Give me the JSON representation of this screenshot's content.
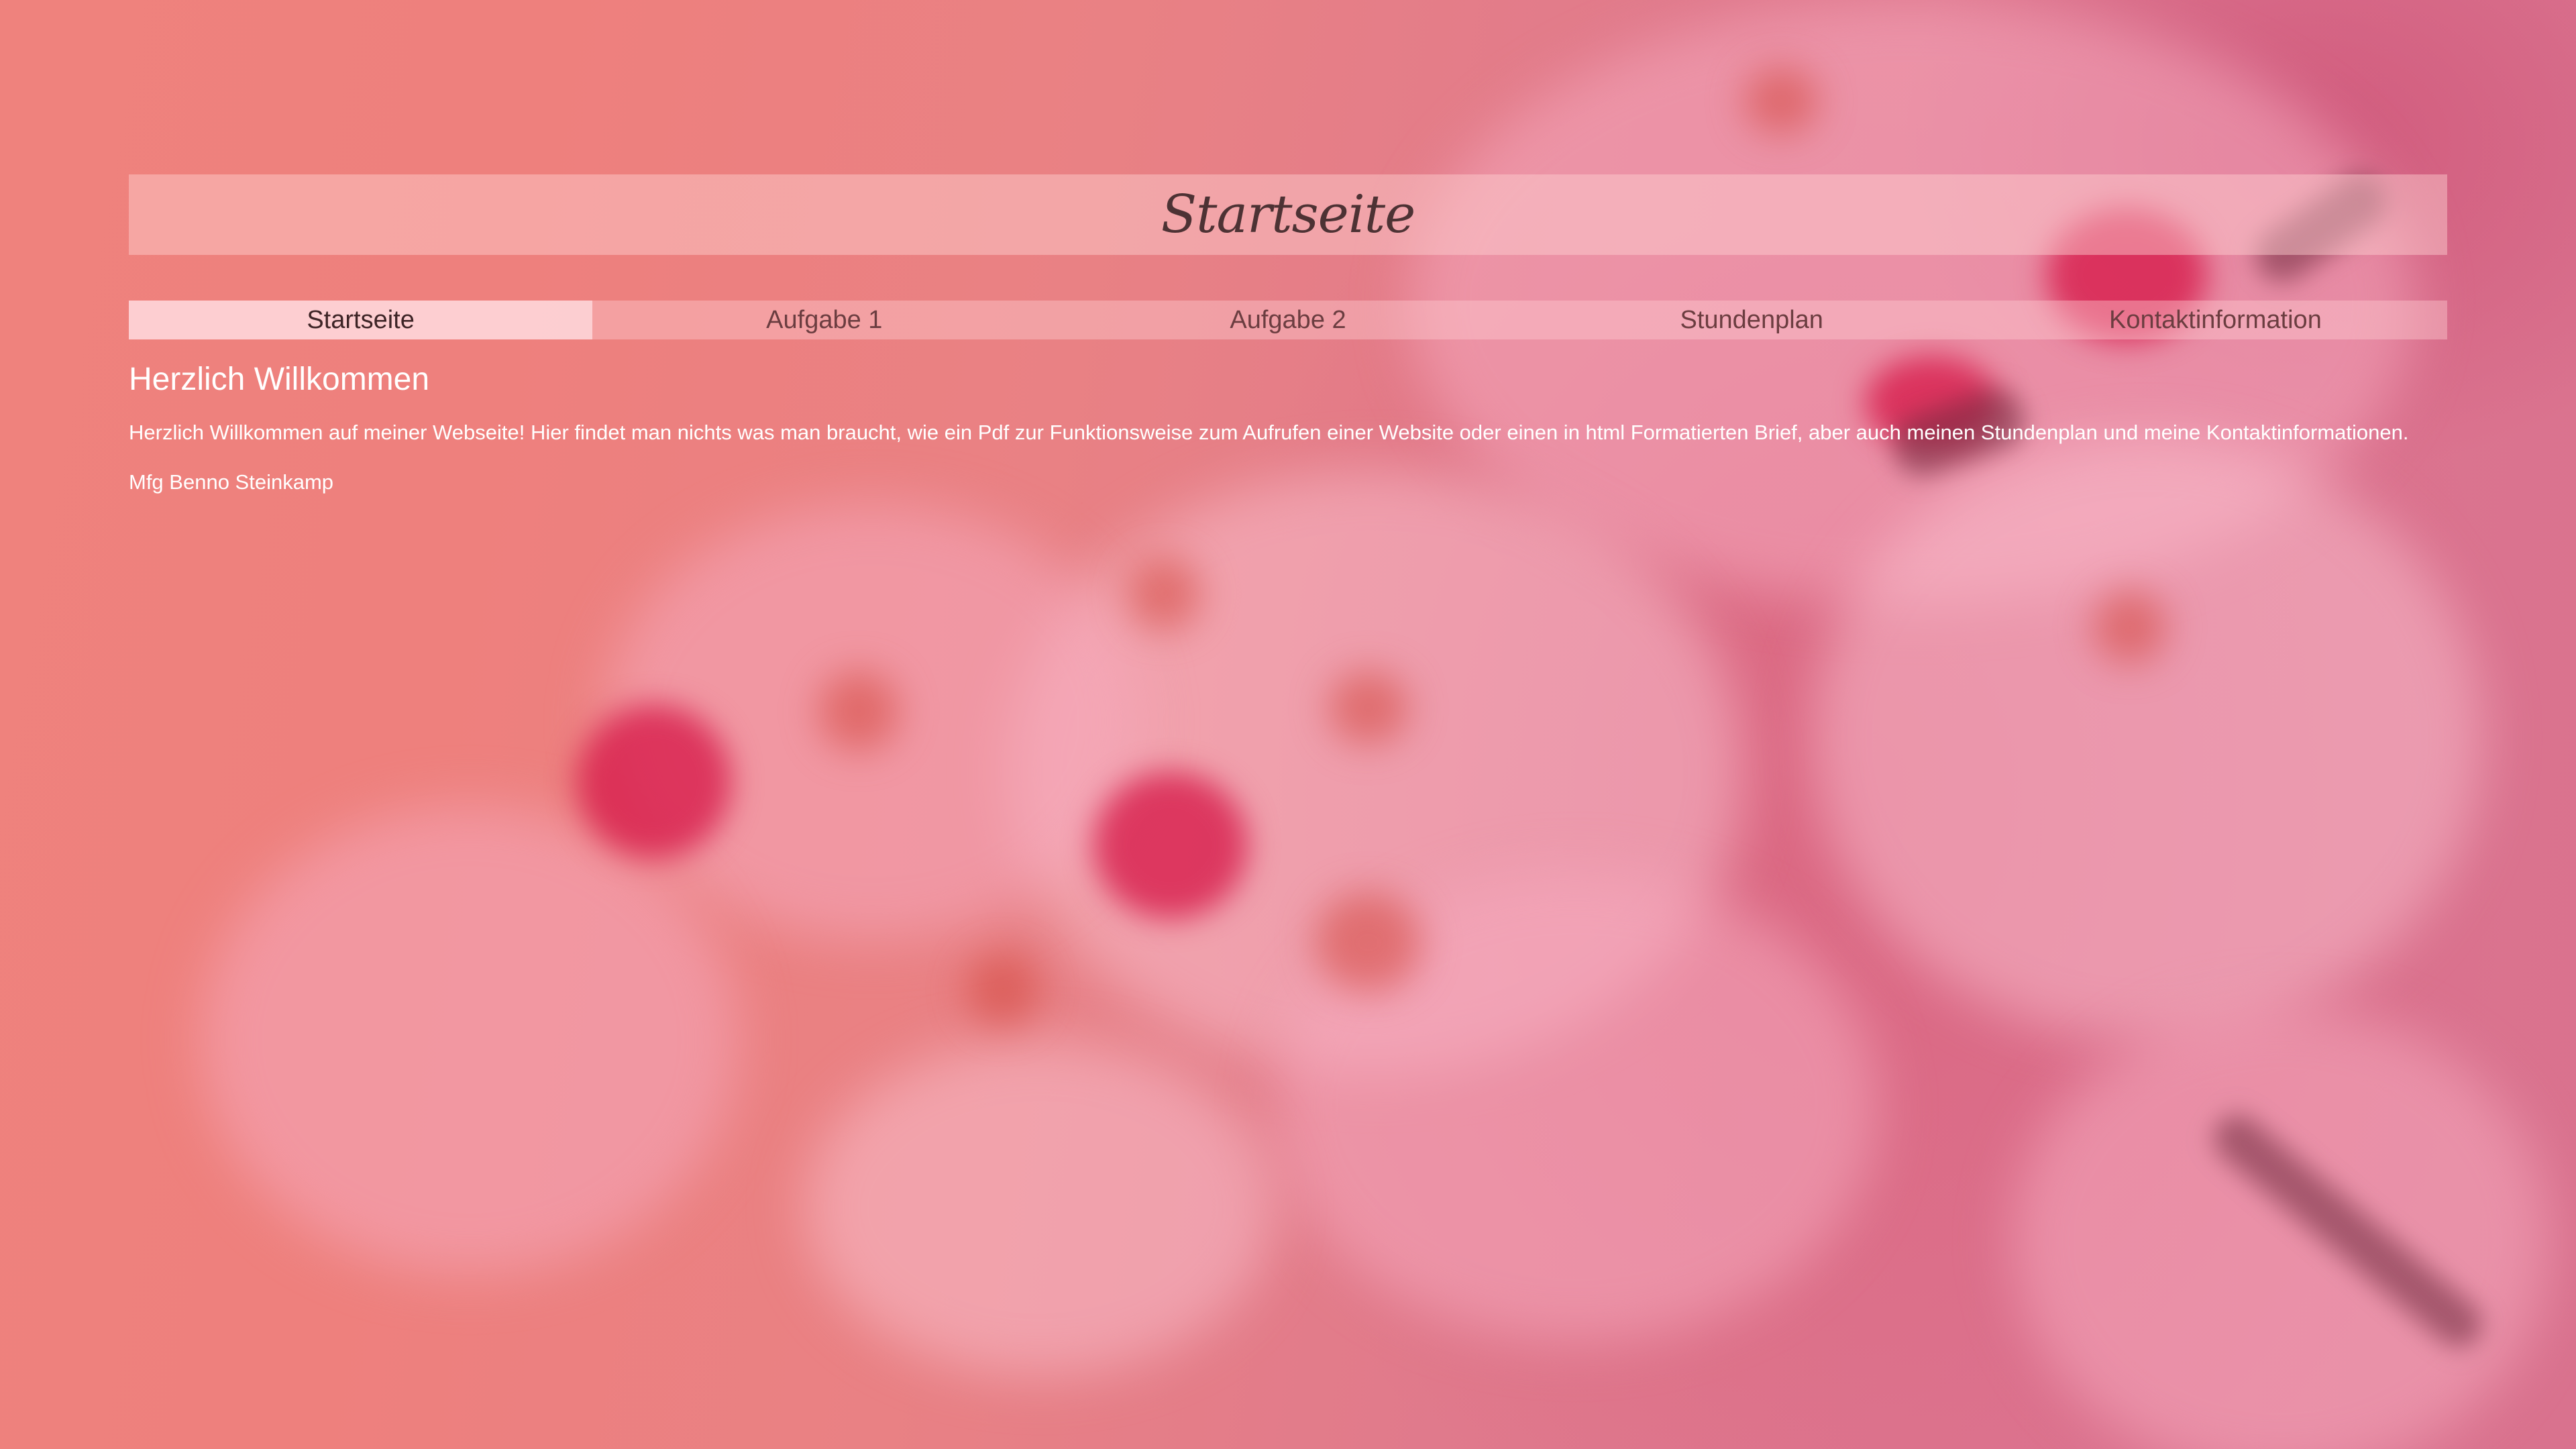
{
  "header": {
    "title": "Startseite"
  },
  "nav": {
    "items": [
      {
        "label": "Startseite",
        "active": true
      },
      {
        "label": "Aufgabe 1",
        "active": false
      },
      {
        "label": "Aufgabe 2",
        "active": false
      },
      {
        "label": "Stundenplan",
        "active": false
      },
      {
        "label": "Kontaktinformation",
        "active": false
      }
    ]
  },
  "main": {
    "heading": "Herzlich Willkommen",
    "intro": "Herzlich Willkommen auf meiner Webseite! Hier findet man nichts was man braucht, wie ein Pdf zur Funktionsweise zum Aufrufen einer Website oder einen in html Formatierten Brief, aber auch meinen Stundenplan und meine Kontaktinformationen.",
    "signature": "Mfg Benno Steinkamp"
  },
  "colors": {
    "background": "#ee817e",
    "title_text": "#4d3234",
    "nav_text": "#6b3d40",
    "content_text": "#ffffff"
  }
}
